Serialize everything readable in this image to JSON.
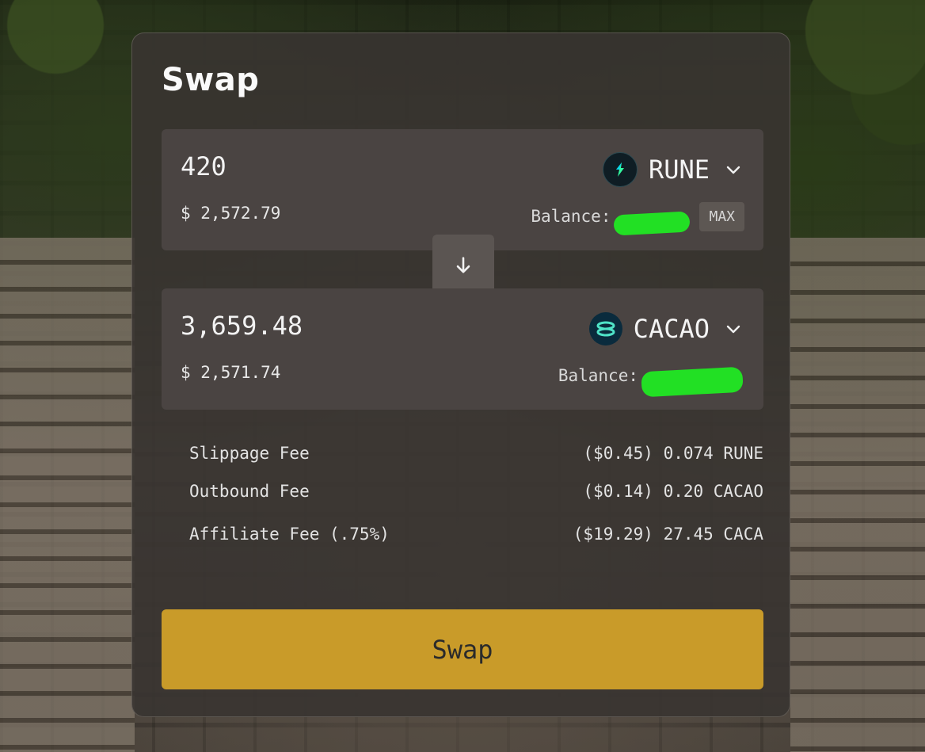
{
  "swap": {
    "title": "Swap",
    "from": {
      "amount": "420",
      "usd_value": "$ 2,572.79",
      "token": "RUNE",
      "token_icon": "thorchain-rune-icon",
      "balance_label": "Balance:",
      "max_label": "MAX"
    },
    "to": {
      "amount": "3,659.48",
      "usd_value": "$ 2,571.74",
      "token": "CACAO",
      "token_icon": "maya-cacao-icon",
      "balance_label": "Balance:"
    },
    "flip_icon": "arrow-down-icon",
    "fees": [
      {
        "label": "Slippage Fee",
        "value": "($0.45) 0.074 RUNE"
      },
      {
        "label": "Outbound Fee",
        "value": "($0.14) 0.20 CACAO"
      },
      {
        "label": "Affiliate Fee (.75%)",
        "value": "($19.29) 27.45 CACA"
      }
    ],
    "submit_label": "Swap"
  },
  "colors": {
    "card_bg": "#383431",
    "panel_bg": "#4a4442",
    "accent": "#c99b29",
    "redaction": "#22e024"
  }
}
